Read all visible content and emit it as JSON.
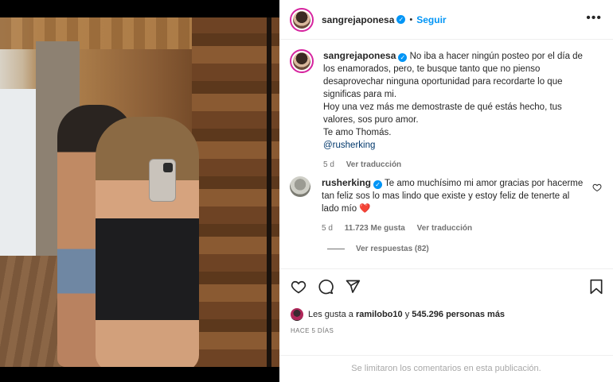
{
  "post": {
    "username": "sangrejaponesa",
    "follow_label": "Seguir",
    "separator": "•",
    "more_label": "•••"
  },
  "caption": {
    "username": "sangrejaponesa",
    "lines": [
      "No iba a hacer ningún posteo por el día de los enamorados, pero, te busque tanto que no pienso desaprovechar ninguna oportunidad para recordarte lo que significas para mi.",
      "Hoy una vez más me demostraste de qué estás hecho, tus valores, sos puro amor.",
      "Te amo Thomás."
    ],
    "mention": "@rusherking",
    "age": "5 d",
    "translate": "Ver traducción"
  },
  "comment": {
    "username": "rusherking",
    "text": "Te amo muchísimo mi amor gracias por hacerme tan feliz sos lo mas lindo que existe y estoy feliz de tenerte al lado mío",
    "emoji": "❤️",
    "age": "5 d",
    "likes": "11.723 Me gusta",
    "translate": "Ver traducción",
    "replies": "Ver respuestas (82)"
  },
  "likes": {
    "prefix": "Les gusta a",
    "user": "ramilobo10",
    "connector": "y",
    "count": "545.296 personas más"
  },
  "ago": "HACE 5 DÍAS",
  "footer": "Se limitaron los comentarios en esta publicación.",
  "colors": {
    "accent": "#0095f6",
    "text": "#262626",
    "muted": "#737373",
    "heart": "#ed4956"
  }
}
